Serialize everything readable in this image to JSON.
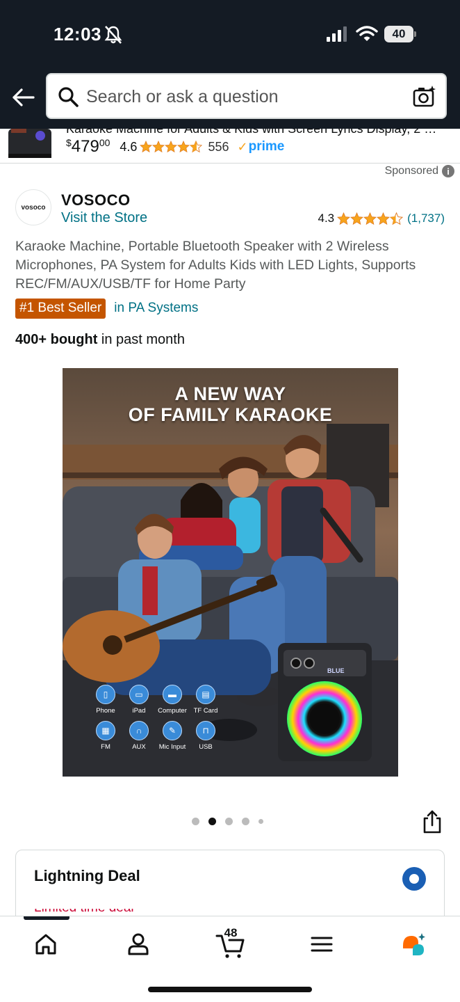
{
  "status_bar": {
    "time": "12:03",
    "battery": "40"
  },
  "search": {
    "placeholder": "Search or ask a question"
  },
  "prev_result": {
    "title": "Karaoke Machine for Adults & Kids with Screen Lyrics Display, 2 …",
    "price_symbol": "$",
    "price_whole": "479",
    "price_fraction": "00",
    "rating": "4.6",
    "review_count": "556",
    "prime_label": "prime"
  },
  "sponsored": {
    "label": "Sponsored"
  },
  "brand": {
    "logo_text": "vosoco",
    "name": "VOSOCO",
    "visit_store": "Visit the Store"
  },
  "product": {
    "rating": "4.3",
    "review_count": "(1,737)",
    "title": "Karaoke Machine, Portable Bluetooth Speaker with 2 Wireless Microphones, PA System for Adults Kids with LED Lights, Supports REC/FM/AUX/USB/TF for Home Party",
    "best_seller_badge": "#1 Best Seller",
    "best_seller_category": "in PA Systems",
    "bought_bold": "400+ bought",
    "bought_rest": " in past month"
  },
  "hero_image": {
    "heading_line1": "A NEW WAY",
    "heading_line2": "OF FAMILY KARAOKE",
    "speaker_label": "BLUE",
    "features": [
      "Phone",
      "iPad",
      "Computer",
      "TF Card",
      "FM",
      "AUX",
      "Mic Input",
      "USB"
    ]
  },
  "carousel": {
    "total": 5,
    "active": 2
  },
  "deal": {
    "title": "Lightning Deal",
    "subtitle": "Limited time deal"
  },
  "tabbar": {
    "cart_count": "48",
    "tabs": [
      "home-icon",
      "account-icon",
      "cart-icon",
      "menu-icon",
      "rufus-icon"
    ]
  },
  "colors": {
    "header_bg": "#141b24",
    "link": "#007185",
    "star": "#f7a41d",
    "badge": "#c45500",
    "prime": "#1a98ff"
  }
}
